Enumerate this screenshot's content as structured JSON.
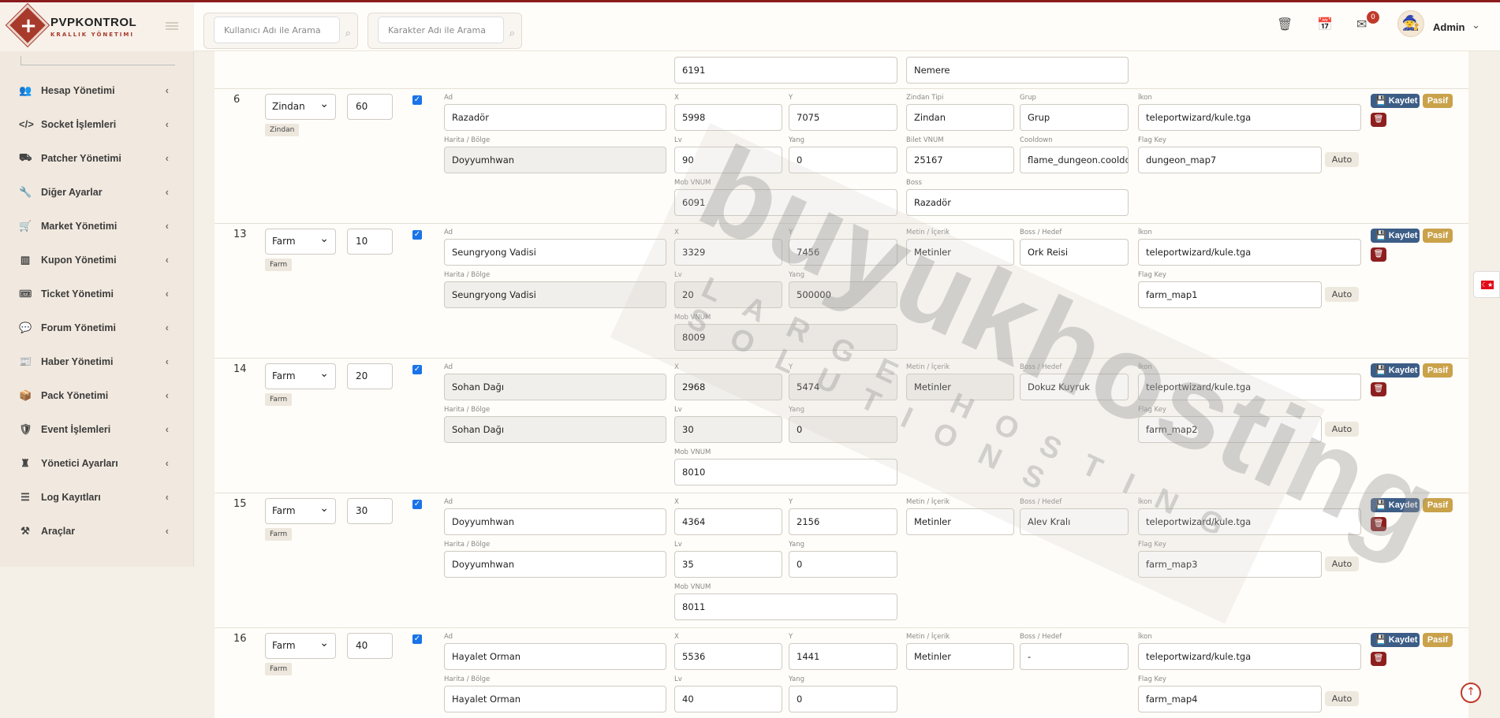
{
  "brand": {
    "title": "PVPKONTROL",
    "subtitle": "KRALLIK YÖNETIMI"
  },
  "header": {
    "search1_placeholder": "Kullanıcı Adı ile Arama",
    "search2_placeholder": "Karakter Adı ile Arama",
    "notification_count": "0",
    "user_name": "Admin"
  },
  "sidebar": {
    "items": [
      {
        "label": "Hesap Yönetimi",
        "icon": "users-icon"
      },
      {
        "label": "Socket İşlemleri",
        "icon": "code-icon"
      },
      {
        "label": "Patcher Yönetimi",
        "icon": "truck-icon"
      },
      {
        "label": "Diğer Ayarlar",
        "icon": "wrench-icon"
      },
      {
        "label": "Market Yönetimi",
        "icon": "cart-icon"
      },
      {
        "label": "Kupon Yönetimi",
        "icon": "barcode-icon"
      },
      {
        "label": "Ticket Yönetimi",
        "icon": "ticket-icon"
      },
      {
        "label": "Forum Yönetimi",
        "icon": "comments-icon"
      },
      {
        "label": "Haber Yönetimi",
        "icon": "newspaper-icon"
      },
      {
        "label": "Pack Yönetimi",
        "icon": "box-icon"
      },
      {
        "label": "Event İşlemleri",
        "icon": "shield-icon"
      },
      {
        "label": "Yönetici Ayarları",
        "icon": "chess-icon"
      },
      {
        "label": "Log Kayıtları",
        "icon": "list-icon"
      },
      {
        "label": "Araçlar",
        "icon": "tools-icon"
      }
    ]
  },
  "labels": {
    "ad": "Ad",
    "x": "X",
    "y": "Y",
    "zindan_tipi": "Zindan Tipi",
    "grup": "Grup",
    "ikon": "İkon",
    "harita": "Harita / Bölge",
    "lv": "Lv",
    "yang": "Yang",
    "bilet": "Bilet VNUM",
    "cooldown": "Cooldown",
    "flag": "Flag Key",
    "mob": "Mob VNUM",
    "boss": "Boss",
    "metin": "Metin / İçerik",
    "boss_hedef": "Boss / Hedef"
  },
  "buttons": {
    "save": "Kaydet",
    "pasif": "Pasif",
    "auto": "Auto"
  },
  "top_partial": {
    "mob": "6191",
    "boss": "Nemere"
  },
  "rows": [
    {
      "id": "6",
      "type": "Zindan",
      "tag": "Zindan",
      "order": "60",
      "ad": "Razadör",
      "x": "5998",
      "y": "7075",
      "c1": "Zindan",
      "c2": "Grup",
      "ikon": "teleportwizard/kule.tga",
      "harita": "Doyyumhwan",
      "lv": "90",
      "yang": "0",
      "bilet": "25167",
      "cooldown": "flame_dungeon.cooldown",
      "flag": "dungeon_map7",
      "mob": "6091",
      "boss": "Razadör"
    },
    {
      "id": "13",
      "type": "Farm",
      "tag": "Farm",
      "order": "10",
      "ad": "Seungryong Vadisi",
      "x": "3329",
      "y": "7456",
      "c1": "Metinler",
      "c2": "Ork Reisi",
      "ikon": "teleportwizard/kule.tga",
      "harita": "Seungryong Vadisi",
      "lv": "20",
      "yang": "500000",
      "flag": "farm_map1",
      "mob": "8009"
    },
    {
      "id": "14",
      "type": "Farm",
      "tag": "Farm",
      "order": "20",
      "ad": "Sohan Dağı",
      "x": "2968",
      "y": "5474",
      "c1": "Metinler",
      "c2": "Dokuz Kuyruk",
      "ikon": "teleportwizard/kule.tga",
      "harita": "Sohan Dağı",
      "lv": "30",
      "yang": "0",
      "flag": "farm_map2",
      "mob": "8010"
    },
    {
      "id": "15",
      "type": "Farm",
      "tag": "Farm",
      "order": "30",
      "ad": "Doyyumhwan",
      "x": "4364",
      "y": "2156",
      "c1": "Metinler",
      "c2": "Alev Kralı",
      "ikon": "teleportwizard/kule.tga",
      "harita": "Doyyumhwan",
      "lv": "35",
      "yang": "0",
      "flag": "farm_map3",
      "mob": "8011"
    },
    {
      "id": "16",
      "type": "Farm",
      "tag": "Farm",
      "order": "40",
      "ad": "Hayalet Orman",
      "x": "5536",
      "y": "1441",
      "c1": "Metinler",
      "c2": "-",
      "ikon": "teleportwizard/kule.tga",
      "harita": "Hayalet Orman",
      "lv": "40",
      "yang": "0",
      "flag": "farm_map4"
    }
  ],
  "watermark": {
    "big": "buyukhosting",
    "small": "LARGE HOSTING SOLUTIONS"
  },
  "colors": {
    "accent": "#a83a2c",
    "save": "#3c5d86",
    "pasif": "#c9a24a",
    "delete": "#8d1f1f"
  }
}
